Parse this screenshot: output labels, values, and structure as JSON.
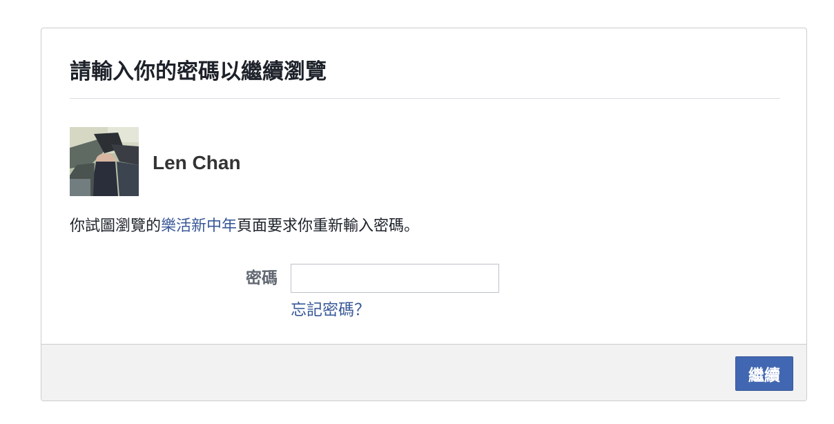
{
  "dialog": {
    "title": "請輸入你的密碼以繼續瀏覽"
  },
  "user": {
    "name": "Len Chan",
    "avatar": "user-profile-photo"
  },
  "message": {
    "prefix": "你試圖瀏覽的",
    "page_link": "樂活新中年",
    "suffix": "頁面要求你重新輸入密碼。"
  },
  "form": {
    "password_label": "密碼",
    "password_value": "",
    "forgot_password_link": "忘記密碼？"
  },
  "footer": {
    "continue_label": "繼續"
  },
  "colors": {
    "link": "#385898",
    "button": "#4267b2",
    "footer_bg": "#f2f2f2",
    "title_text": "#1d2129"
  }
}
